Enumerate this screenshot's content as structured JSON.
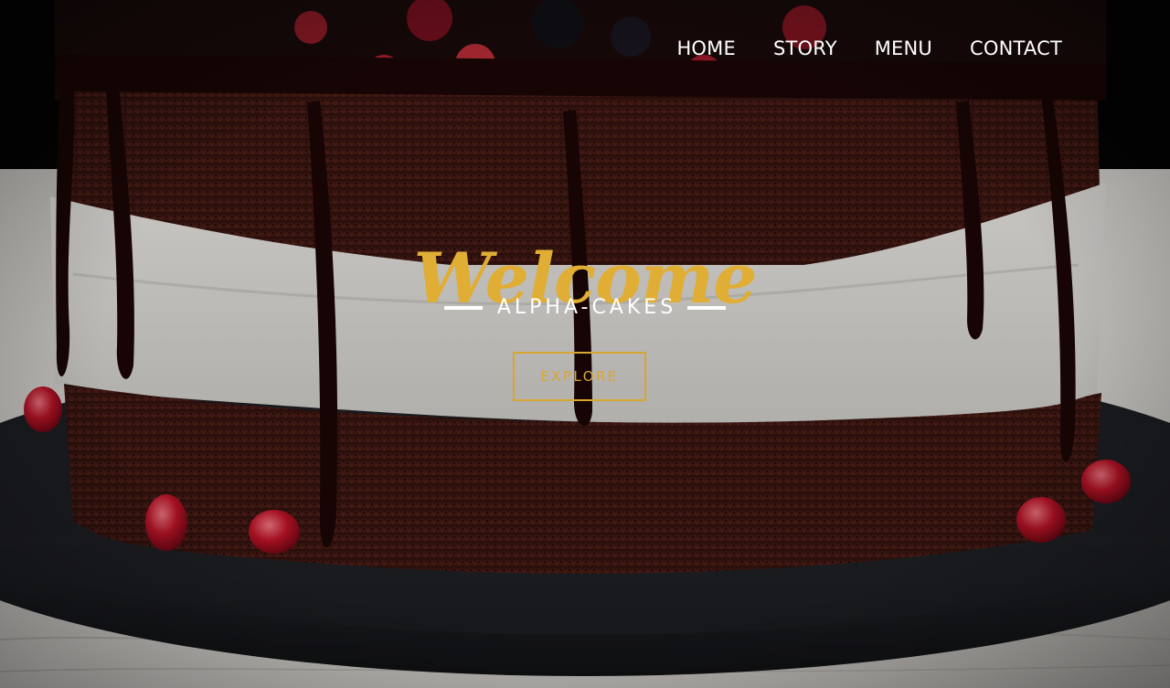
{
  "nav": {
    "items": [
      {
        "label": "HOME"
      },
      {
        "label": "STORY"
      },
      {
        "label": "MENU"
      },
      {
        "label": "CONTACT"
      }
    ]
  },
  "hero": {
    "heading": "Welcome",
    "subtitle": "ALPHA-CAKES",
    "cta_label": "EXPLORE",
    "background_image": "chocolate-layer-cake-photo"
  },
  "colors": {
    "accent_gold": "#e0ad35",
    "text_white": "#ffffff",
    "overlay_dark": "#000000"
  }
}
